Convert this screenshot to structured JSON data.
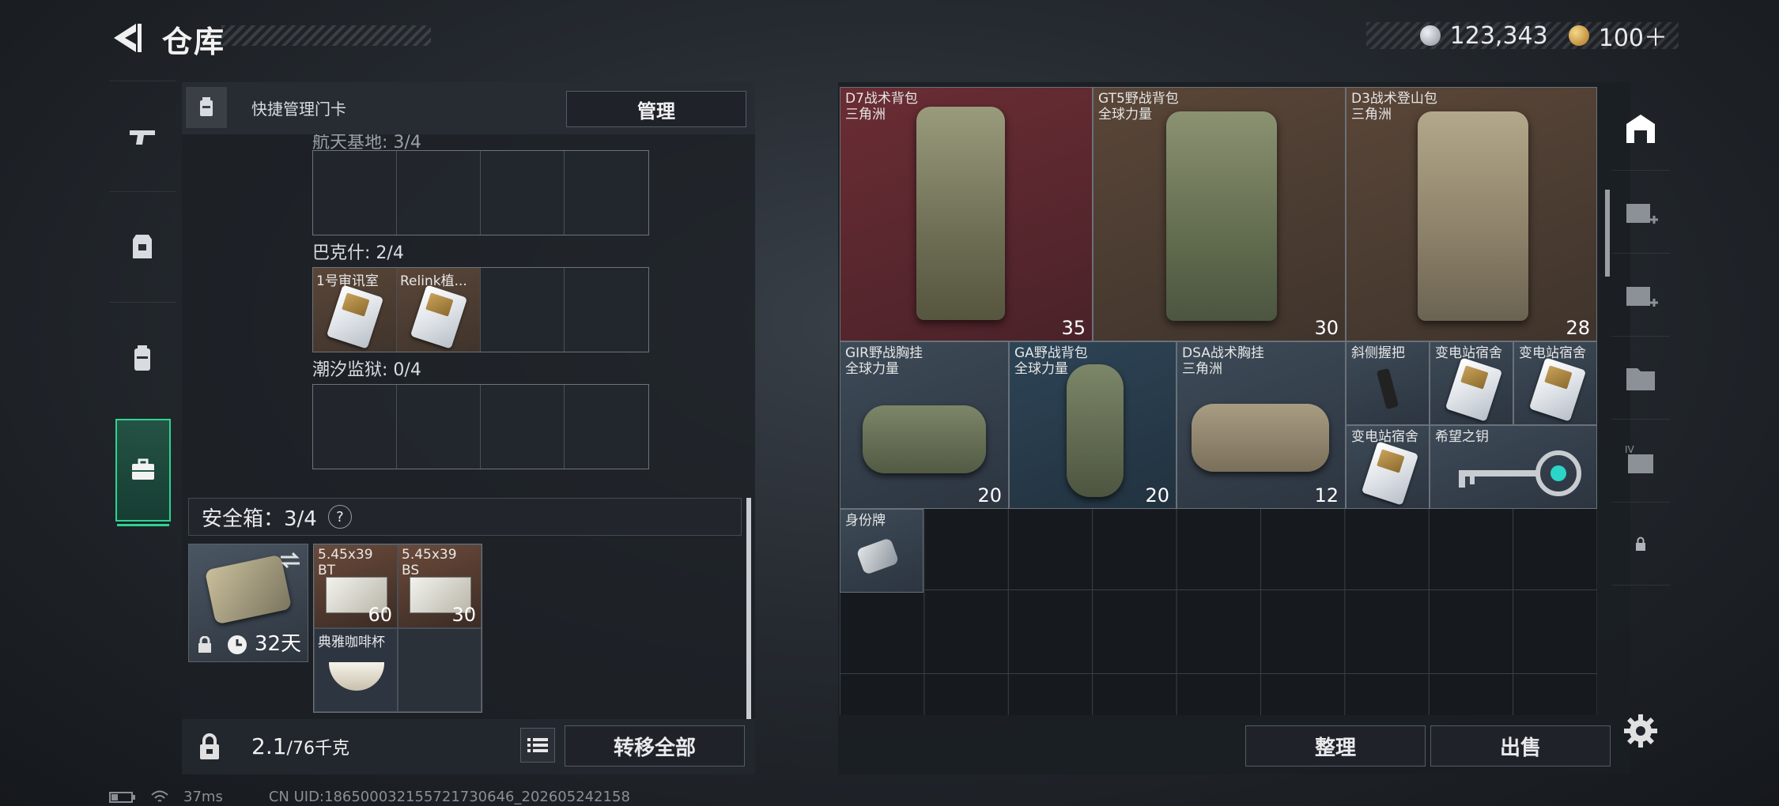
{
  "header": {
    "title": "仓库",
    "silver": "123,343",
    "gold": "100＋"
  },
  "quick": {
    "label": "快捷管理门卡",
    "manage": "管理"
  },
  "sections": [
    {
      "label": "航天基地: 3/4"
    },
    {
      "label": "巴克什: 2/4",
      "cells": [
        "1号审讯室",
        "Relink植..."
      ]
    },
    {
      "label": "潮汐监狱: 0/4"
    }
  ],
  "safe": {
    "label": "安全箱：3/4",
    "help": "?",
    "days": "32天"
  },
  "safe_items": [
    {
      "name": "5.45x39 BT",
      "count": "60"
    },
    {
      "name": "5.45x39 BS",
      "count": "30"
    },
    {
      "name": "典雅咖啡杯"
    }
  ],
  "bottom": {
    "weight": "2.1",
    "weight_max": "/76千克",
    "transfer": "转移全部",
    "sort": "整理",
    "sell": "出售"
  },
  "stash": [
    {
      "name": "D7战术背包",
      "sub": "三角洲",
      "count": "35"
    },
    {
      "name": "GT5野战背包",
      "sub": "全球力量",
      "count": "30"
    },
    {
      "name": "D3战术登山包",
      "sub": "三角洲",
      "count": "28"
    },
    {
      "name": "GIR野战胸挂",
      "sub": "全球力量",
      "count": "20"
    },
    {
      "name": "GA野战背包",
      "sub": "全球力量",
      "count": "20"
    },
    {
      "name": "DSA战术胸挂",
      "sub": "三角洲",
      "count": "12"
    },
    {
      "name": "斜侧握把"
    },
    {
      "name": "变电站宿舍"
    },
    {
      "name": "变电站宿舍"
    },
    {
      "name": "变电站宿舍"
    },
    {
      "name": "希望之钥"
    },
    {
      "name": "身份牌"
    }
  ],
  "status": {
    "ping": "37ms",
    "uid": "CN UID:186500032155721730646_202605242158"
  },
  "colors": {
    "accent": "#2bd58e",
    "red_slot": "#6b2d34",
    "blue_slot": "#2d4456"
  }
}
